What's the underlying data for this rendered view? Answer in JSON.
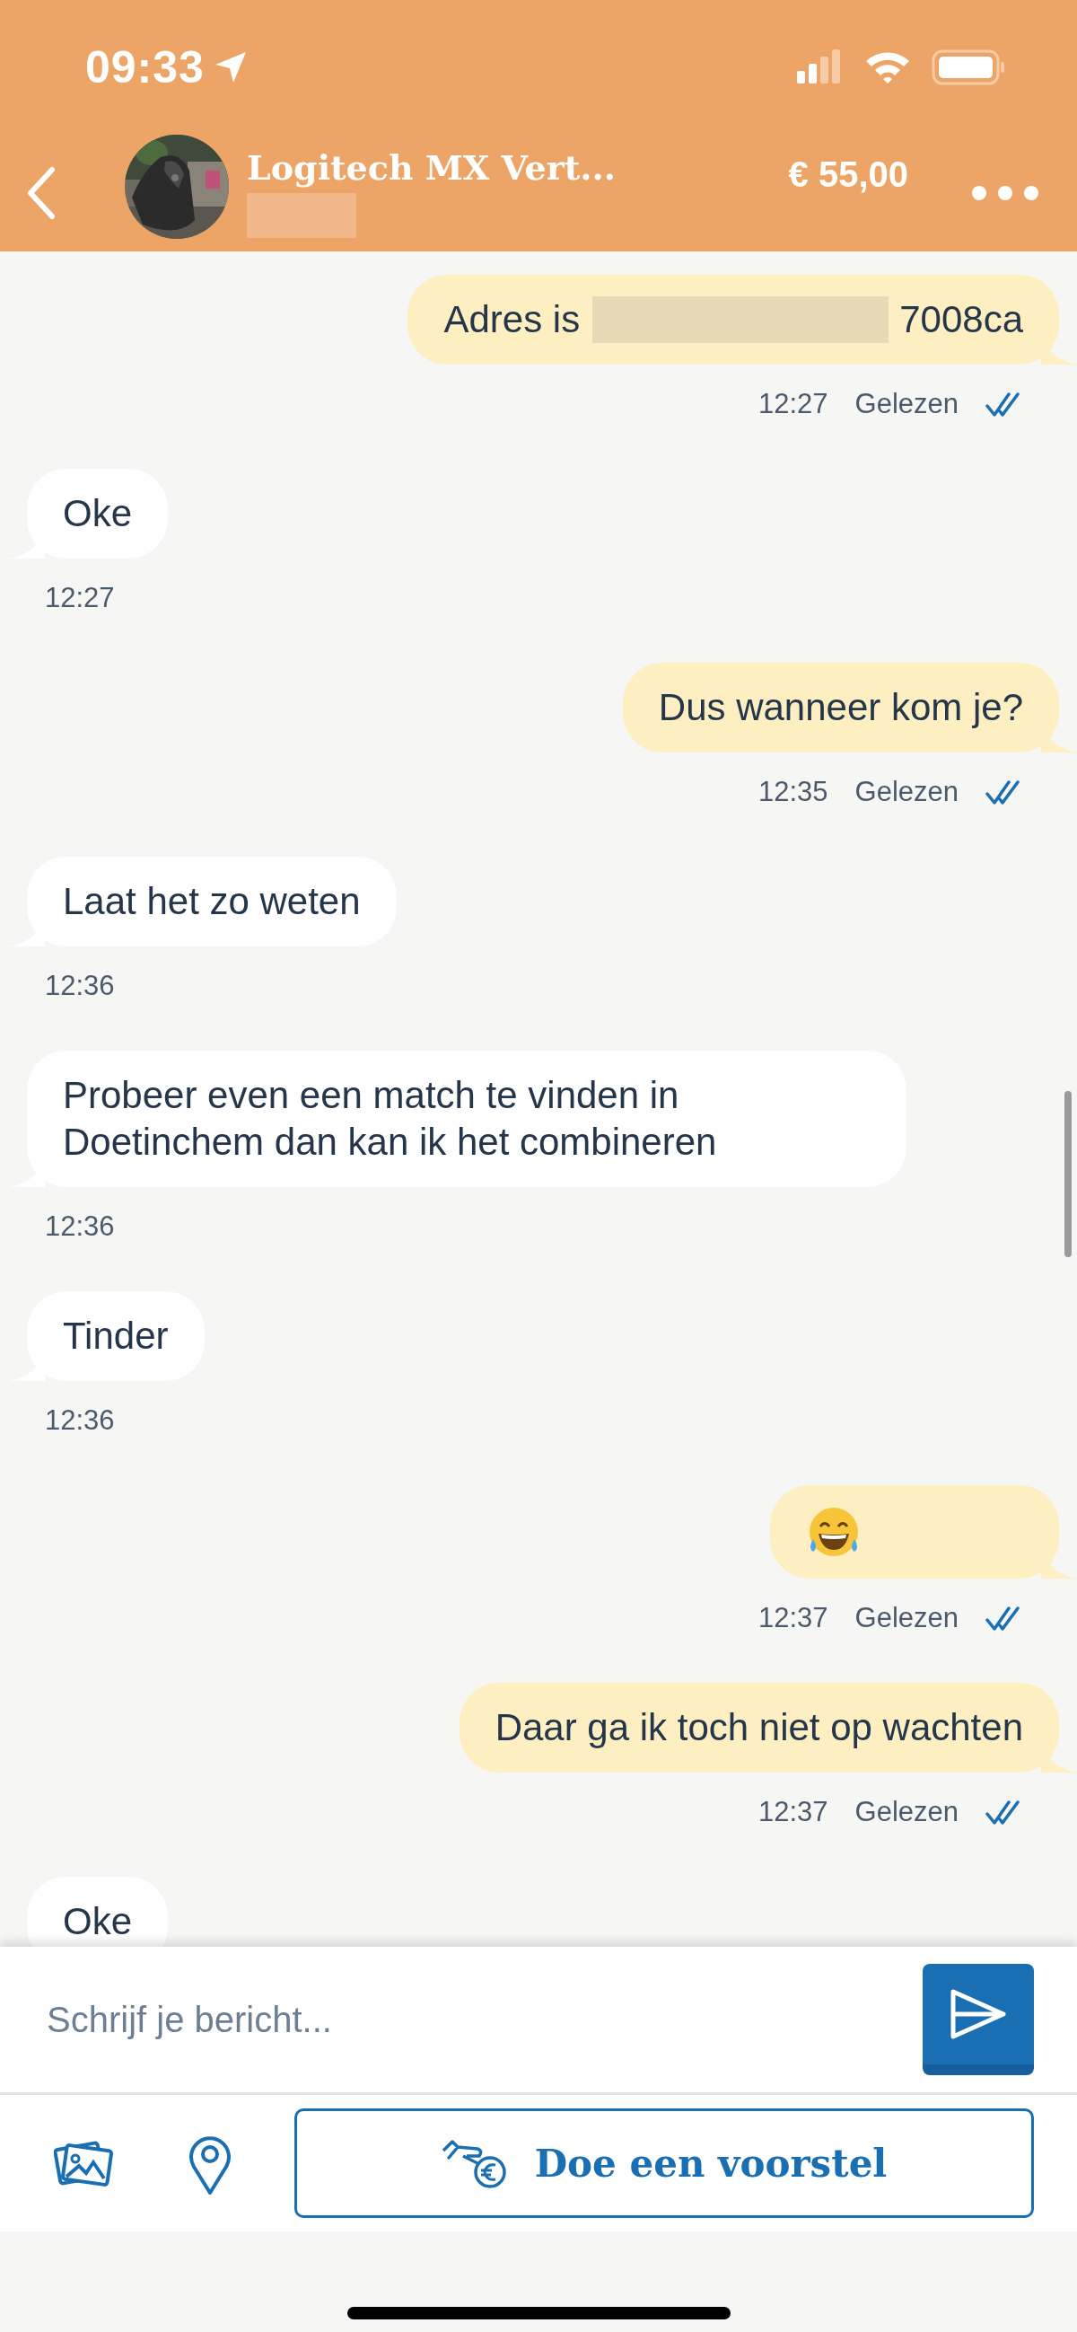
{
  "status_bar": {
    "time": "09:33",
    "location_active": true
  },
  "header": {
    "title": "Logitech MX Vert...",
    "subtitle_redacted": true,
    "price": "€ 55,00"
  },
  "messages": [
    {
      "kind": "outgoing",
      "text": "Adres is",
      "redacted": true,
      "text_after": "7008ca",
      "time": "12:27",
      "status": "Gelezen",
      "read": true
    },
    {
      "kind": "incoming",
      "text": "Oke",
      "time": "12:27"
    },
    {
      "kind": "outgoing",
      "text": "Dus wanneer kom je?",
      "time": "12:35",
      "status": "Gelezen",
      "read": true
    },
    {
      "kind": "incoming",
      "text": "Laat het zo weten",
      "time": "12:36"
    },
    {
      "kind": "incoming",
      "text": "Probeer even een match te vinden in Doetinchem dan kan ik het combineren",
      "time": "12:36"
    },
    {
      "kind": "incoming",
      "text": "Tinder",
      "time": "12:36"
    },
    {
      "kind": "emoji",
      "time": "12:37",
      "status": "Gelezen",
      "read": true
    },
    {
      "kind": "outgoing",
      "text": "Daar ga ik toch niet op wachten",
      "time": "12:37",
      "status": "Gelezen",
      "read": true
    },
    {
      "kind": "incoming",
      "text": "Oke"
    }
  ],
  "composer": {
    "placeholder": "Schrijf je bericht...",
    "offer_button": "Doe een voorstel"
  }
}
